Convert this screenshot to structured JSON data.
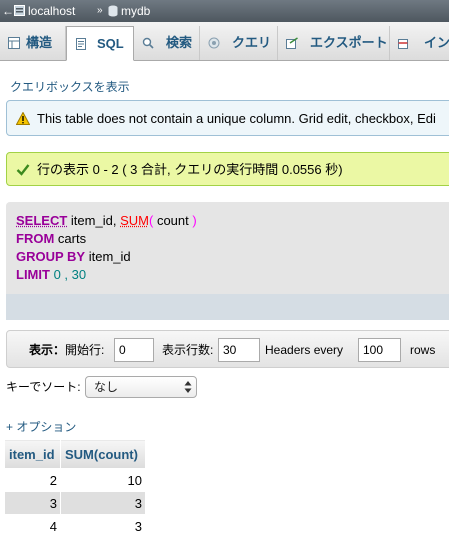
{
  "breadcrumb": {
    "server": "localhost",
    "separator": "»",
    "database": "mydb"
  },
  "tabs": [
    {
      "label": "構造",
      "icon": "structure-icon",
      "active": false
    },
    {
      "label": "SQL",
      "icon": "sql-icon",
      "active": true
    },
    {
      "label": "検索",
      "icon": "search-icon",
      "active": false
    },
    {
      "label": "クエリ",
      "icon": "query-icon",
      "active": false
    },
    {
      "label": "エクスポート",
      "icon": "export-icon",
      "active": false
    },
    {
      "label": "イン",
      "icon": "import-icon",
      "active": false
    }
  ],
  "show_query_link": "クエリボックスを表示",
  "warning": {
    "text": "This table does not contain a unique column. Grid edit, checkbox, Edi",
    "icon": "warning-icon"
  },
  "success": {
    "text": "行の表示 0 - 2 ( 3 合計, クエリの実行時間 0.0556 秒)",
    "icon": "check-icon"
  },
  "sql": {
    "select_kw": "SELECT",
    "col1": "item_id,",
    "fn": "SUM",
    "paren_open": "(",
    "col2": "count",
    "paren_close": ")",
    "from_kw": "FROM",
    "table": "carts",
    "group_kw": "GROUP BY",
    "group_col": "item_id",
    "limit_kw": "LIMIT",
    "limit_start": "0",
    "limit_sep": ",",
    "limit_count": "30"
  },
  "nav": {
    "show_label": "表示：",
    "start_label": "開始行:",
    "start_value": "0",
    "rows_label": "表示行数:",
    "rows_value": "30",
    "headers_label": "Headers every",
    "headers_value": "100",
    "rows_suffix": "rows"
  },
  "sort": {
    "label": "キーでソート:",
    "value": "なし"
  },
  "options_link": "+ オプション",
  "table": {
    "headers": [
      "item_id",
      "SUM(count)"
    ],
    "rows": [
      [
        "2",
        "10"
      ],
      [
        "3",
        "3"
      ],
      [
        "4",
        "3"
      ]
    ]
  },
  "colors": {
    "link": "#235a81",
    "keyword": "#990099",
    "function": "#ff0000",
    "number": "#008080"
  }
}
